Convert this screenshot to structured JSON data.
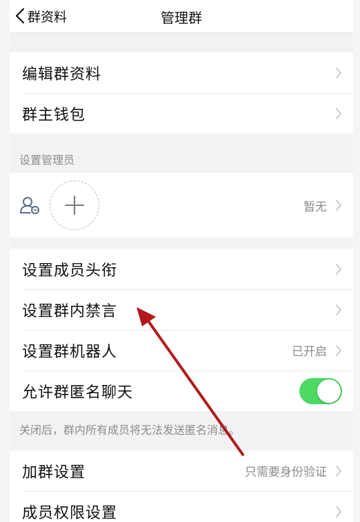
{
  "navbar": {
    "back_label": "群资料",
    "title": "管理群"
  },
  "group1": {
    "items": [
      {
        "label": "编辑群资料"
      },
      {
        "label": "群主钱包"
      }
    ]
  },
  "admin_section": {
    "caption": "设置管理员",
    "status": "暂无"
  },
  "group3": {
    "items": [
      {
        "label": "设置成员头衔",
        "value": ""
      },
      {
        "label": "设置群内禁言",
        "value": ""
      },
      {
        "label": "设置群机器人",
        "value": "已开启"
      },
      {
        "label": "允许群匿名聊天",
        "toggle": true
      }
    ]
  },
  "anon_hint": "关闭后，群内所有成员将无法发送匿名消息。",
  "group4": {
    "items": [
      {
        "label": "加群设置",
        "value": "只需要身份验证"
      },
      {
        "label": "成员权限设置",
        "value": ""
      }
    ]
  },
  "colors": {
    "toggle_on": "#4cd964",
    "annotation_arrow": "#b3191b"
  }
}
